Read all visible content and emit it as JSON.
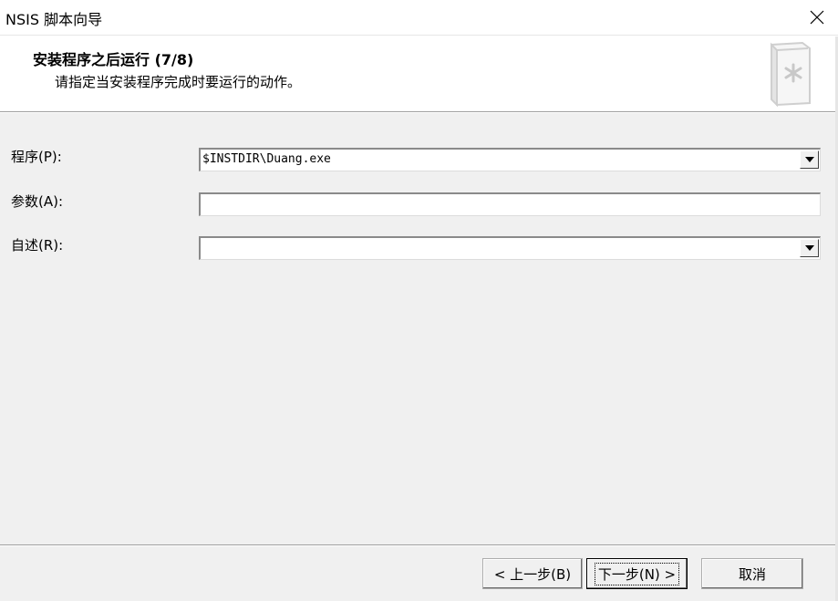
{
  "window": {
    "title": "NSIS 脚本向导",
    "close_icon": "close-icon"
  },
  "header": {
    "title": "安装程序之后运行 (7/8)",
    "subtitle": "请指定当安装程序完成时要运行的动作。",
    "icon": "wizard-book-icon"
  },
  "form": {
    "program_label": "程序(P):",
    "program_value": "$INSTDIR\\Duang.exe",
    "params_label": "参数(A):",
    "params_value": "",
    "readme_label": "自述(R):",
    "readme_value": ""
  },
  "buttons": {
    "back": "< 上一步(B)",
    "next": "下一步(N) >",
    "cancel": "取消"
  }
}
